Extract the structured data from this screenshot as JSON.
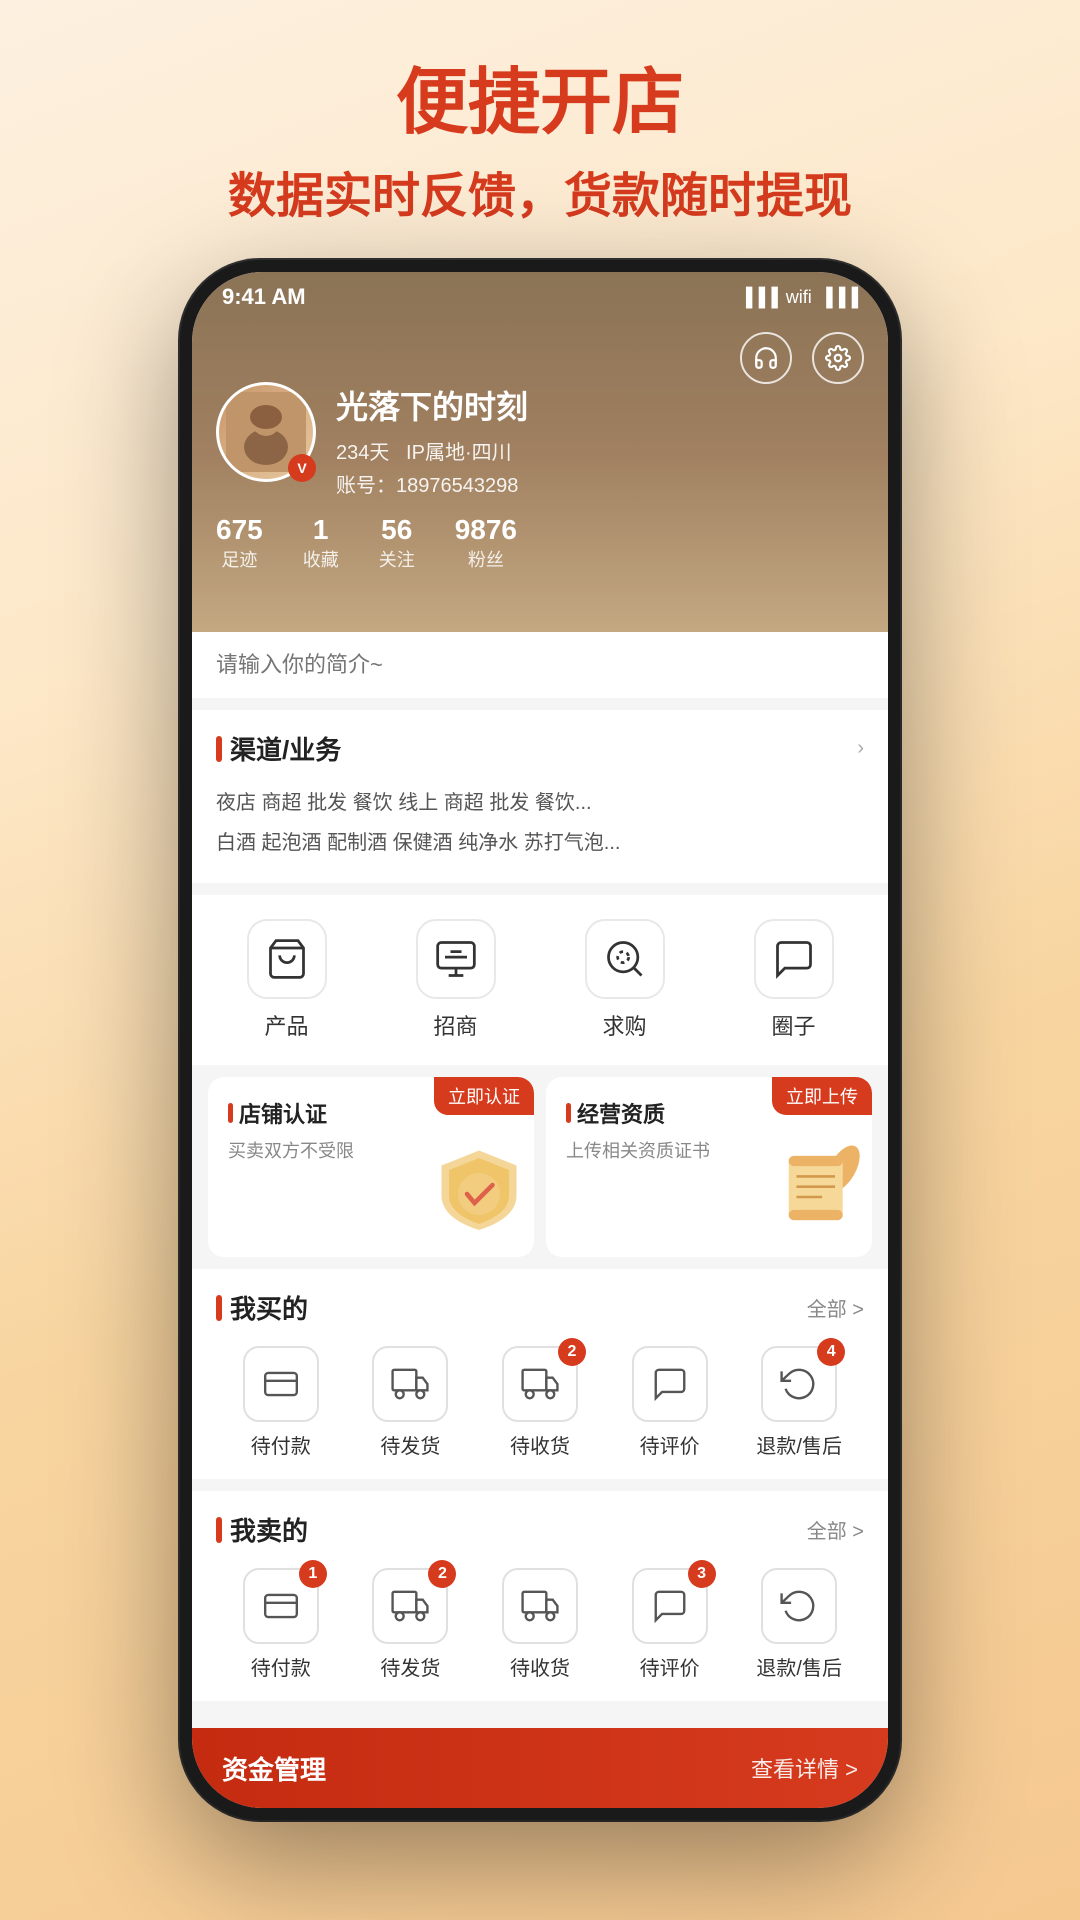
{
  "page": {
    "title": "便捷开店",
    "subtitle": "数据实时反馈，货款随时提现",
    "bg_gradient_start": "#fdf0e0",
    "bg_gradient_end": "#f5c890"
  },
  "status_bar": {
    "time": "9:41 AM",
    "icons": [
      "signal",
      "wifi",
      "battery"
    ]
  },
  "profile": {
    "name": "光落下的时刻",
    "days": "234天",
    "ip": "IP属地·四川",
    "account_label": "账号：",
    "account_number": "18976543298",
    "v_badge": "V",
    "stats": [
      {
        "num": "675",
        "label": "足迹"
      },
      {
        "num": "1",
        "label": "收藏"
      },
      {
        "num": "56",
        "label": "关注"
      },
      {
        "num": "9876",
        "label": "粉丝"
      }
    ],
    "header_icons": {
      "headset": "🎧",
      "settings": "⚙"
    }
  },
  "bio": {
    "placeholder": "请输入你的简介~"
  },
  "channel": {
    "title": "渠道/业务",
    "tags_line1": "夜店  商超  批发  餐饮  线上  商超  批发  餐饮...",
    "tags_line2": "白酒  起泡酒  配制酒  保健酒  纯净水  苏打气泡..."
  },
  "quick_actions": [
    {
      "icon": "🛍",
      "label": "产品"
    },
    {
      "icon": "📋",
      "label": "招商"
    },
    {
      "icon": "🔍",
      "label": "求购"
    },
    {
      "icon": "💬",
      "label": "圈子"
    }
  ],
  "certification": [
    {
      "title": "店铺认证",
      "badge": "立即认证",
      "desc": "买卖双方不受限",
      "icon": "🔰"
    },
    {
      "title": "经营资质",
      "badge": "立即上传",
      "desc": "上传相关资质证书",
      "icon": "📜"
    }
  ],
  "my_purchases": {
    "section_title": "我买的",
    "all_label": "全部 >",
    "items": [
      {
        "icon": "💳",
        "label": "待付款",
        "badge": null
      },
      {
        "icon": "📦",
        "label": "待发货",
        "badge": null
      },
      {
        "icon": "🚚",
        "label": "待收货",
        "badge": "2"
      },
      {
        "icon": "💬",
        "label": "待评价",
        "badge": null
      },
      {
        "icon": "↩",
        "label": "退款/售后",
        "badge": "4"
      }
    ]
  },
  "my_sales": {
    "section_title": "我卖的",
    "all_label": "全部 >",
    "items": [
      {
        "icon": "💳",
        "label": "待付款",
        "badge": "1"
      },
      {
        "icon": "📦",
        "label": "待发货",
        "badge": "2"
      },
      {
        "icon": "🚚",
        "label": "待收货",
        "badge": null
      },
      {
        "icon": "💬",
        "label": "待评价",
        "badge": "3"
      },
      {
        "icon": "↩",
        "label": "退款/售后",
        "badge": null
      }
    ]
  },
  "bottom_bar": {
    "title": "资金管理",
    "link": "查看详情 >"
  }
}
